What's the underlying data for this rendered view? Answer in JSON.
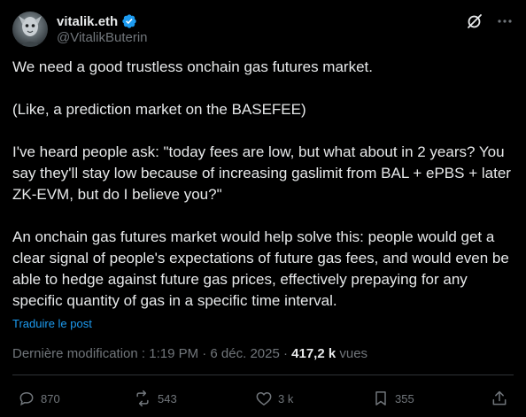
{
  "author": {
    "display_name": "vitalik.eth",
    "handle": "@VitalikButerin",
    "verified": true
  },
  "tweet": {
    "paragraphs": [
      "We need a good trustless onchain gas futures market.",
      "(Like, a prediction market on the BASEFEE)",
      "I've heard people ask: \"today fees are low, but what about in 2 years? You say they'll stay low because of increasing gaslimit from BAL + ePBS + later ZK-EVM, but do I believe you?\"",
      "An onchain gas futures market would help solve this: people would get a clear signal of people's expectations of future gas fees, and would even be able to hedge against future gas prices, effectively prepaying for any specific quantity of gas in a specific time interval."
    ],
    "translate_label": "Traduire le post"
  },
  "meta": {
    "prefix": "Dernière modification : 1:19 PM · 6 déc. 2025 · ",
    "views_count": "417,2 k",
    "views_label": " vues"
  },
  "actions": {
    "replies": "870",
    "reposts": "543",
    "likes": "3 k",
    "bookmarks": "355"
  },
  "colors": {
    "background": "#000000",
    "text": "#e7e9ea",
    "secondary": "#71767b",
    "accent": "#1d9bf0"
  },
  "icons": {
    "verified": "verified-badge-icon",
    "grok": "grok-icon",
    "more": "more-icon",
    "reply": "reply-icon",
    "repost": "repost-icon",
    "like": "like-icon",
    "bookmark": "bookmark-icon",
    "share": "share-icon"
  }
}
